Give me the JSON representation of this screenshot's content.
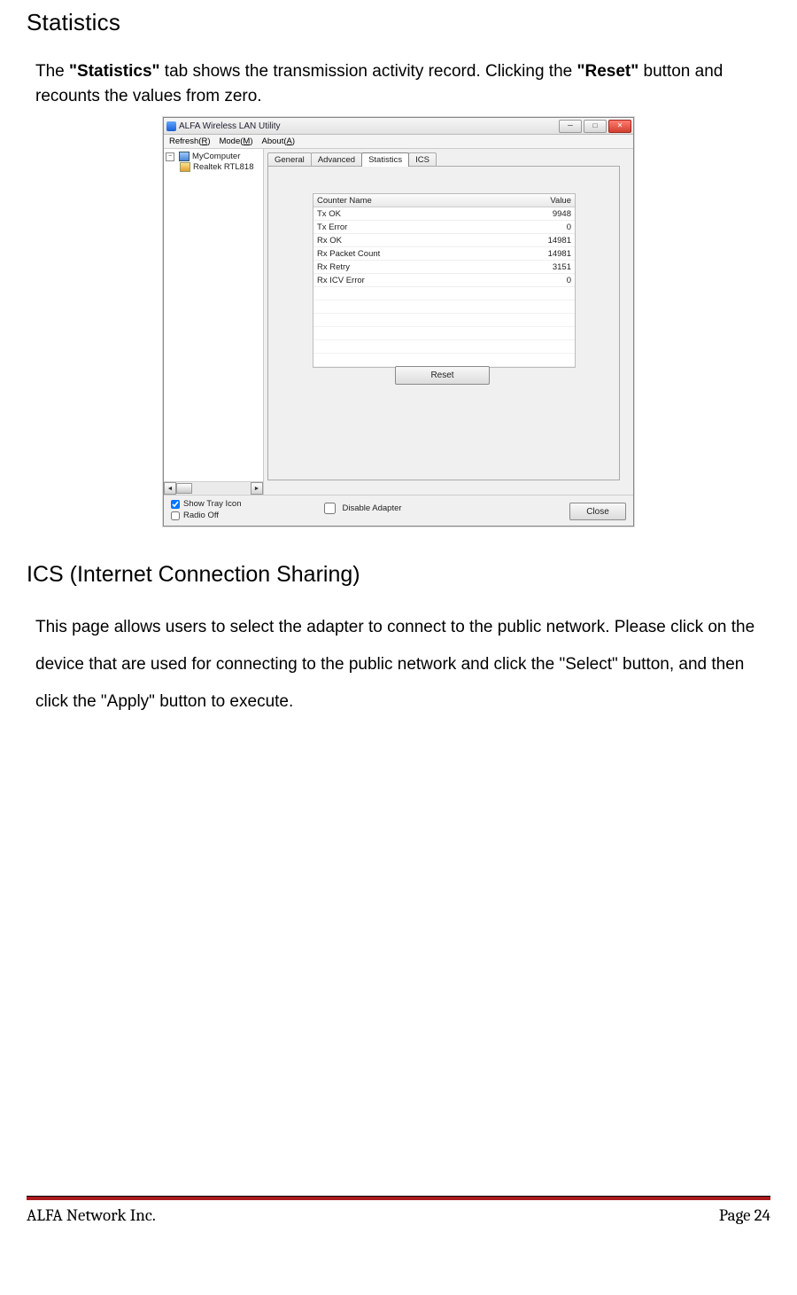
{
  "heading1": "Statistics",
  "para1": {
    "t1": "The ",
    "b1": "\"Statistics\"",
    "t2": " tab shows the transmission activity record. Clicking the ",
    "b2": "\"Reset\"",
    "t3": " button and recounts the values from zero."
  },
  "window": {
    "title": "ALFA Wireless LAN Utility",
    "menu": {
      "refresh": "Refresh(R)",
      "mode": "Mode(M)",
      "about": "About(A)"
    },
    "winbtns": {
      "min": "─",
      "max": "□",
      "close": "✕"
    },
    "tree": {
      "root": "MyComputer",
      "child": "Realtek RTL818",
      "expander": "−"
    },
    "scroll": {
      "left": "◄",
      "right": "►"
    },
    "tabs": {
      "general": "General",
      "advanced": "Advanced",
      "statistics": "Statistics",
      "ics": "ICS"
    },
    "table": {
      "h1": "Counter Name",
      "h2": "Value",
      "rows": [
        {
          "name": "Tx OK",
          "value": "9948"
        },
        {
          "name": "Tx Error",
          "value": "0"
        },
        {
          "name": "Rx OK",
          "value": "14981"
        },
        {
          "name": "Rx Packet Count",
          "value": "14981"
        },
        {
          "name": "Rx Retry",
          "value": "3151"
        },
        {
          "name": "Rx ICV Error",
          "value": "0"
        }
      ]
    },
    "reset": "Reset",
    "bottom": {
      "showtray": "Show Tray Icon",
      "radiooff": "Radio Off",
      "disable": "Disable Adapter",
      "close": "Close"
    }
  },
  "heading2": "ICS (Internet Connection Sharing)",
  "para2": "This page allows users to select the adapter to connect to the public network. Please click on the device that are used for connecting to the public network and click the \"Select\" button, and then click the \"Apply\" button to execute.",
  "footer": {
    "left": "ALFA Network Inc.",
    "right": "Page 24"
  },
  "chart_data": {
    "type": "table",
    "title": "Statistics",
    "columns": [
      "Counter Name",
      "Value"
    ],
    "rows": [
      [
        "Tx OK",
        9948
      ],
      [
        "Tx Error",
        0
      ],
      [
        "Rx OK",
        14981
      ],
      [
        "Rx Packet Count",
        14981
      ],
      [
        "Rx Retry",
        3151
      ],
      [
        "Rx ICV Error",
        0
      ]
    ]
  }
}
